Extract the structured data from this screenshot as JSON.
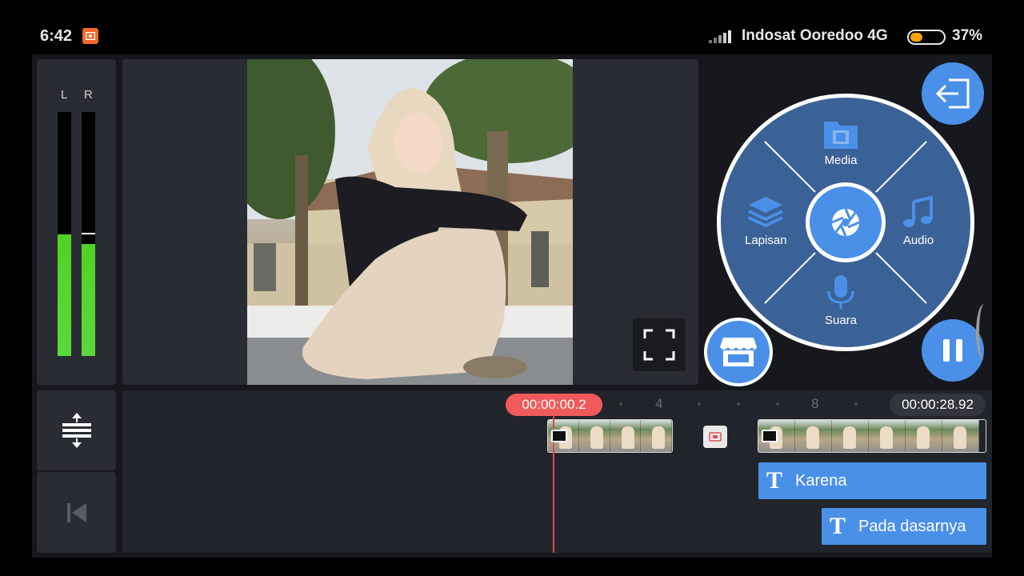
{
  "status_bar": {
    "time": "6:42",
    "carrier": "Indosat Ooredoo 4G",
    "battery_percent": "37%",
    "battery_level": 0.37
  },
  "vu_meter": {
    "left_label": "L",
    "right_label": "R",
    "left_level": 0.5,
    "right_level": 0.46,
    "right_peak": 0.5
  },
  "wheel": {
    "media_label": "Media",
    "audio_label": "Audio",
    "voice_label": "Suara",
    "layer_label": "Lapisan"
  },
  "timeline": {
    "current_time": "00:00:00.2",
    "total_time": "00:00:28.92",
    "ruler_marks": [
      "4",
      "8"
    ]
  },
  "text_layers": [
    {
      "label": "Karena"
    },
    {
      "label": "Pada dasarnya"
    }
  ],
  "colors": {
    "accent": "#4a90e8",
    "playhead": "#f05a5a",
    "vu_green": "#4fd126"
  }
}
